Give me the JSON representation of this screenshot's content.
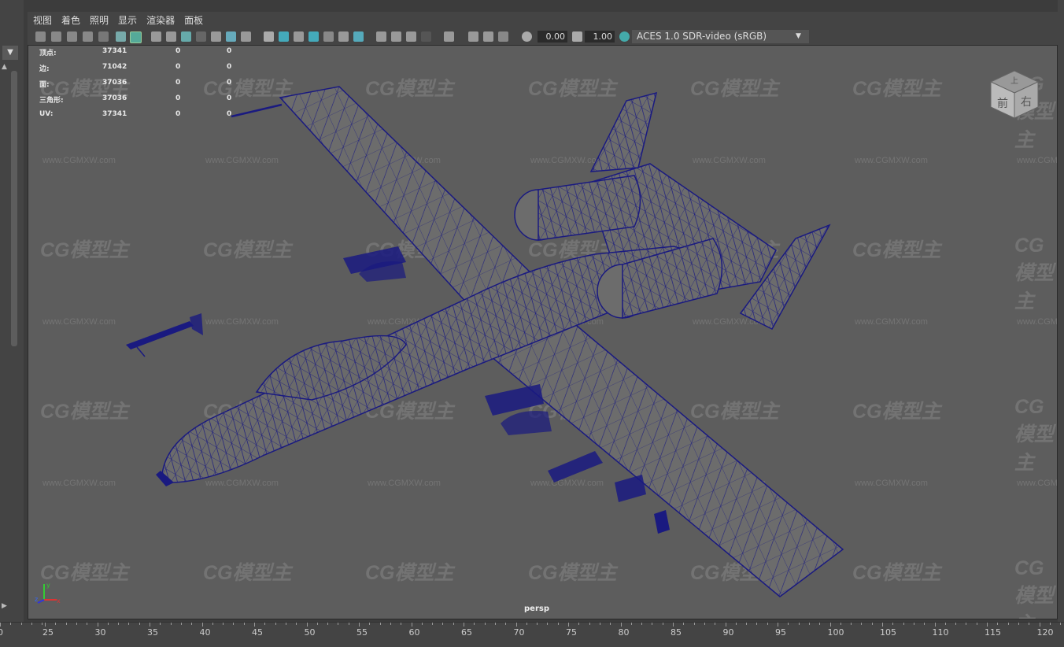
{
  "menu": [
    "视图",
    "着色",
    "照明",
    "显示",
    "渲染器",
    "面板"
  ],
  "toolbar": {
    "exposure": "0.00",
    "gamma": "1.00",
    "color_management": "ACES 1.0 SDR-video (sRGB)"
  },
  "stats": [
    {
      "label": "顶点:",
      "v1": "37341",
      "v2": "0",
      "v3": "0"
    },
    {
      "label": "边:",
      "v1": "71042",
      "v2": "0",
      "v3": "0"
    },
    {
      "label": "面:",
      "v1": "37036",
      "v2": "0",
      "v3": "0"
    },
    {
      "label": "三角形:",
      "v1": "37036",
      "v2": "0",
      "v3": "0"
    },
    {
      "label": "UV:",
      "v1": "37341",
      "v2": "0",
      "v3": "0"
    }
  ],
  "camera_label": "persp",
  "view_cube": {
    "top": "上",
    "front": "前",
    "right": "右"
  },
  "watermark": {
    "logo": "CG模型主",
    "url": "www.CGMXW.com"
  },
  "timeline": [
    "0",
    "25",
    "30",
    "35",
    "40",
    "45",
    "50",
    "55",
    "60",
    "65",
    "70",
    "75",
    "80",
    "85",
    "90",
    "95",
    "100",
    "105",
    "110",
    "115",
    "120"
  ],
  "colors": {
    "wireframe": "#1a1a80",
    "viewport_bg": "#5d5d5d",
    "ui_bg": "#444444"
  },
  "axis": {
    "x": "x",
    "y": "y",
    "z": "z"
  }
}
